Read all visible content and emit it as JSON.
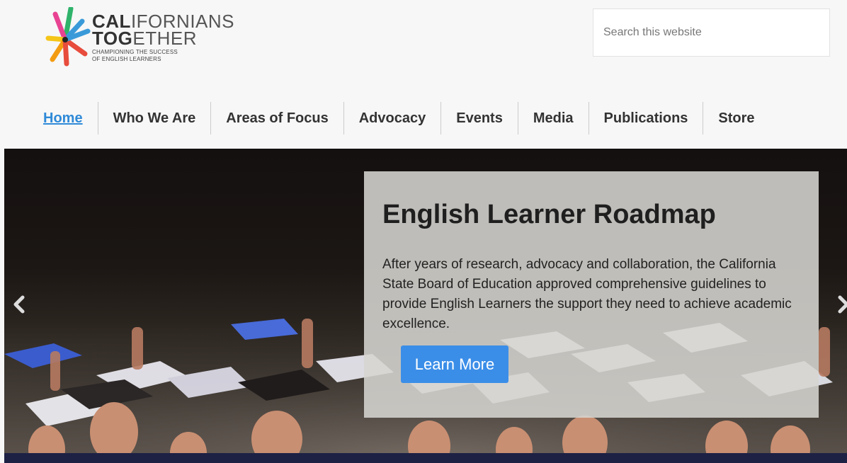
{
  "logo": {
    "line1_bold": "CAL",
    "line1_rest": "IFORNIANS",
    "line2_bold": "TOG",
    "line2_rest": "ETHER",
    "tagline1": "CHAMPIONING THE SUCCESS",
    "tagline2": "OF ENGLISH LEARNERS"
  },
  "search": {
    "placeholder": "Search this website"
  },
  "nav": {
    "items": [
      {
        "label": "Home",
        "active": true
      },
      {
        "label": "Who We Are"
      },
      {
        "label": "Areas of Focus"
      },
      {
        "label": "Advocacy"
      },
      {
        "label": "Events"
      },
      {
        "label": "Media"
      },
      {
        "label": "Publications"
      },
      {
        "label": "Store"
      }
    ]
  },
  "hero": {
    "title": "English Learner Roadmap",
    "body": "After years of research, advocacy and collaboration, the California State Board of Education approved comprehensive guidelines to provide English Learners the support they need to achieve academic excellence.",
    "button_label": "Learn More",
    "prev_icon": "chevron-left-icon",
    "next_icon": "chevron-right-icon"
  },
  "colors": {
    "accent": "#2f8ad8",
    "button": "#3b8ee8",
    "nav_text": "#333333"
  }
}
